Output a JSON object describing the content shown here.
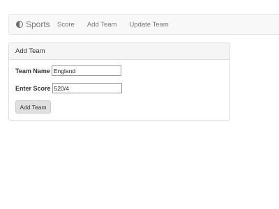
{
  "navbar": {
    "brand_icon": "half-circle-icon",
    "brand_label": "Sports",
    "links": [
      {
        "label": "Score"
      },
      {
        "label": "Add Team"
      },
      {
        "label": "Update Team"
      }
    ]
  },
  "panel": {
    "title": "Add Team",
    "team_name": {
      "label": "Team Name",
      "value": "England"
    },
    "score": {
      "label": "Enter Score",
      "value": "520/4"
    },
    "submit_label": "Add Team"
  }
}
